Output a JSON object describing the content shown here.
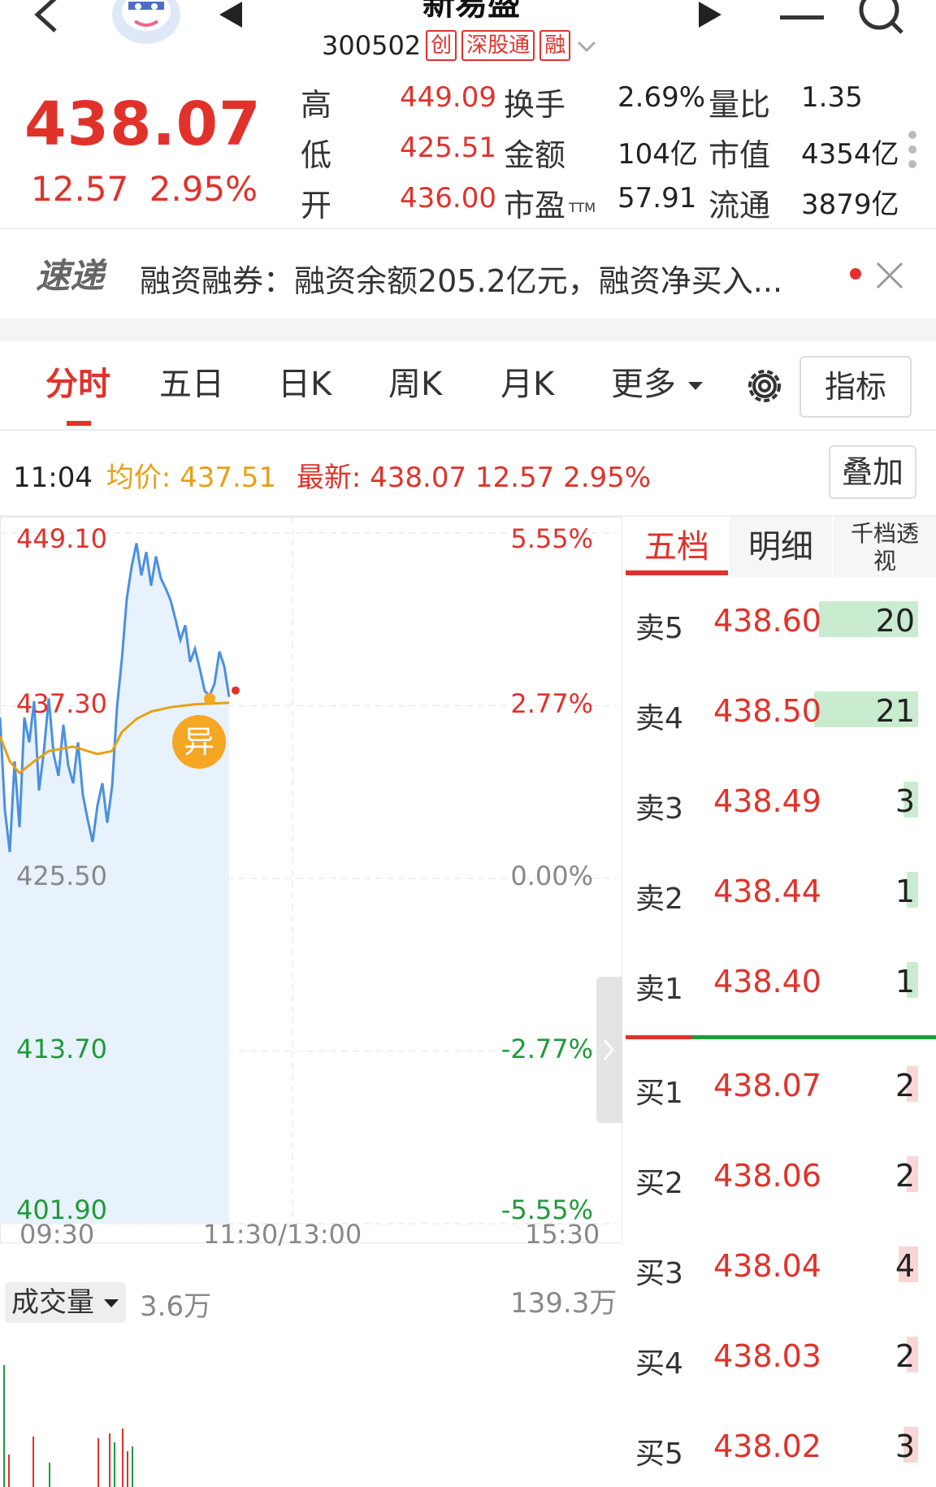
{
  "header": {
    "title": "新易盛",
    "code": "300502",
    "tags": [
      "创",
      "深股通",
      "融"
    ]
  },
  "quote": {
    "price": "438.07",
    "change": "12.57",
    "change_pct": "2.95%",
    "stats": [
      {
        "label": "高",
        "value": "449.09",
        "color": "#e0322b"
      },
      {
        "label": "低",
        "value": "425.51",
        "color": "#e0322b"
      },
      {
        "label": "开",
        "value": "436.00",
        "color": "#e0322b"
      },
      {
        "label": "换手",
        "value": "2.69%",
        "color": "#222222"
      },
      {
        "label": "金额",
        "value": "104亿",
        "color": "#222222"
      },
      {
        "label": "市盈",
        "sub": "TTM",
        "value": "57.91",
        "color": "#222222"
      },
      {
        "label": "量比",
        "value": "1.35",
        "color": "#222222"
      },
      {
        "label": "市值",
        "value": "4354亿",
        "color": "#222222"
      },
      {
        "label": "流通",
        "value": "3879亿",
        "color": "#222222"
      }
    ]
  },
  "news": {
    "badge": "速递",
    "text": "融资融券：融资余额205.2亿元，融资净买入..."
  },
  "tabs": [
    "分时",
    "五日",
    "日K",
    "周K",
    "月K",
    "更多"
  ],
  "indicator_button": "指标",
  "overlay_button": "叠加",
  "info_line": {
    "time": "11:04",
    "avg_label": "均价:",
    "avg_value": "437.51",
    "latest_label": "最新:",
    "latest_value": "438.07 12.57 2.95%"
  },
  "chart_data": {
    "type": "line",
    "y_left_ticks": [
      "449.10",
      "437.30",
      "425.50",
      "413.70",
      "401.90"
    ],
    "y_right_ticks": [
      "5.55%",
      "2.77%",
      "0.00%",
      "-2.77%",
      "-5.55%"
    ],
    "x_ticks": [
      "09:30",
      "11:30/13:00",
      "15:30"
    ],
    "ylim": [
      401.9,
      449.1
    ],
    "session_minutes": 240,
    "series": [
      {
        "color": "#4a90e2",
        "points": [
          [
            0,
            436.5
          ],
          [
            2,
            430.2
          ],
          [
            4,
            427.3
          ],
          [
            6,
            433.5
          ],
          [
            8,
            429.0
          ],
          [
            10,
            436.5
          ],
          [
            12,
            434.8
          ],
          [
            14,
            437.6
          ],
          [
            16,
            431.5
          ],
          [
            18,
            434.2
          ],
          [
            20,
            437.8
          ],
          [
            22,
            434.0
          ],
          [
            24,
            432.5
          ],
          [
            26,
            436.0
          ],
          [
            28,
            433.2
          ],
          [
            30,
            432.0
          ],
          [
            32,
            434.8
          ],
          [
            34,
            431.2
          ],
          [
            36,
            429.5
          ],
          [
            38,
            428.0
          ],
          [
            40,
            430.5
          ],
          [
            42,
            432.0
          ],
          [
            44,
            429.3
          ],
          [
            46,
            431.8
          ],
          [
            48,
            437.2
          ],
          [
            50,
            440.5
          ],
          [
            52,
            444.6
          ],
          [
            54,
            446.8
          ],
          [
            56,
            448.4
          ],
          [
            58,
            446.2
          ],
          [
            60,
            447.8
          ],
          [
            62,
            445.5
          ],
          [
            64,
            447.5
          ],
          [
            66,
            446.0
          ],
          [
            68,
            445.3
          ],
          [
            70,
            444.5
          ],
          [
            72,
            443.2
          ],
          [
            74,
            441.8
          ],
          [
            76,
            442.8
          ],
          [
            78,
            440.3
          ],
          [
            80,
            441.2
          ],
          [
            82,
            439.8
          ],
          [
            84,
            438.3
          ],
          [
            86,
            438.0
          ],
          [
            88,
            438.8
          ],
          [
            90,
            441.0
          ],
          [
            92,
            440.0
          ],
          [
            94,
            437.9
          ]
        ]
      },
      {
        "color": "#e8a015",
        "points": [
          [
            0,
            435.2
          ],
          [
            4,
            433.5
          ],
          [
            8,
            432.7
          ],
          [
            14,
            433.5
          ],
          [
            20,
            434.2
          ],
          [
            30,
            434.5
          ],
          [
            40,
            434.0
          ],
          [
            46,
            434.2
          ],
          [
            50,
            435.5
          ],
          [
            56,
            436.4
          ],
          [
            62,
            436.9
          ],
          [
            70,
            437.2
          ],
          [
            80,
            437.4
          ],
          [
            94,
            437.5
          ]
        ]
      }
    ]
  },
  "chart_badge": "异",
  "volume": {
    "label": "成交量",
    "value": "3.6万",
    "max": "139.3万"
  },
  "orderbook": {
    "tabs": [
      "五档",
      "明细",
      "千档透视"
    ],
    "asks": [
      {
        "name": "卖5",
        "price": "438.60",
        "vol": "20"
      },
      {
        "name": "卖4",
        "price": "438.50",
        "vol": "21"
      },
      {
        "name": "卖3",
        "price": "438.49",
        "vol": "3"
      },
      {
        "name": "卖2",
        "price": "438.44",
        "vol": "1"
      },
      {
        "name": "卖1",
        "price": "438.40",
        "vol": "1"
      }
    ],
    "bids": [
      {
        "name": "买1",
        "price": "438.07",
        "vol": "2"
      },
      {
        "name": "买2",
        "price": "438.06",
        "vol": "2"
      },
      {
        "name": "买3",
        "price": "438.04",
        "vol": "4"
      },
      {
        "name": "买4",
        "price": "438.03",
        "vol": "2"
      },
      {
        "name": "买5",
        "price": "438.02",
        "vol": "3"
      }
    ]
  },
  "icons": [
    "back-arrow-icon",
    "avatar",
    "prev-icon",
    "next-icon",
    "minus-icon",
    "search-icon",
    "more-icon",
    "close-icon",
    "gear-icon",
    "dropdown-icon",
    "collapse-icon"
  ]
}
